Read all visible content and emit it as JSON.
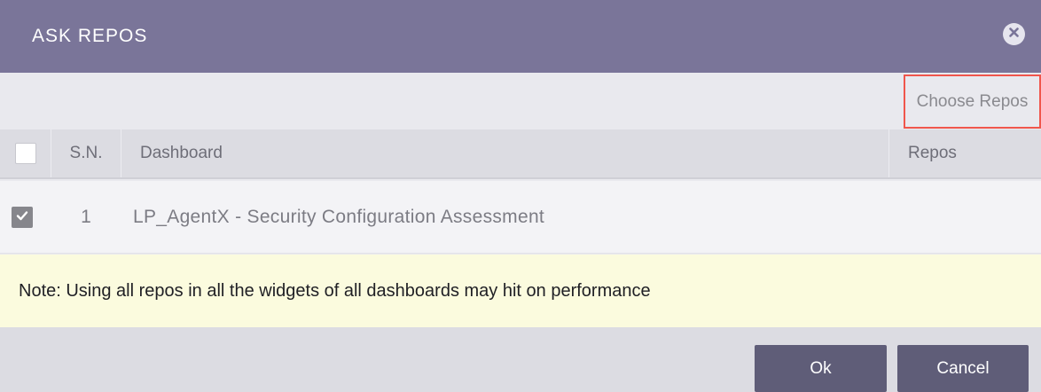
{
  "dialog": {
    "title": "ASK REPOS",
    "close_icon": "close-circle-icon"
  },
  "toolbar": {
    "choose_repos_label": "Choose Repos"
  },
  "table": {
    "headers": {
      "select_all": "",
      "sn": "S.N.",
      "dashboard": "Dashboard",
      "repos": "Repos"
    },
    "select_all_checked": false,
    "rows": [
      {
        "checked": true,
        "sn": "1",
        "dashboard": "LP_AgentX - Security Configuration Assessment",
        "repos": ""
      }
    ]
  },
  "note": {
    "text": "Note: Using all repos in all the widgets of all dashboards may hit on performance"
  },
  "footer": {
    "ok_label": "Ok",
    "cancel_label": "Cancel"
  },
  "colors": {
    "header_bg": "#7a7599",
    "highlight_border": "#f0564c",
    "button_bg": "#5f5d78",
    "note_bg": "#fbfbde"
  }
}
